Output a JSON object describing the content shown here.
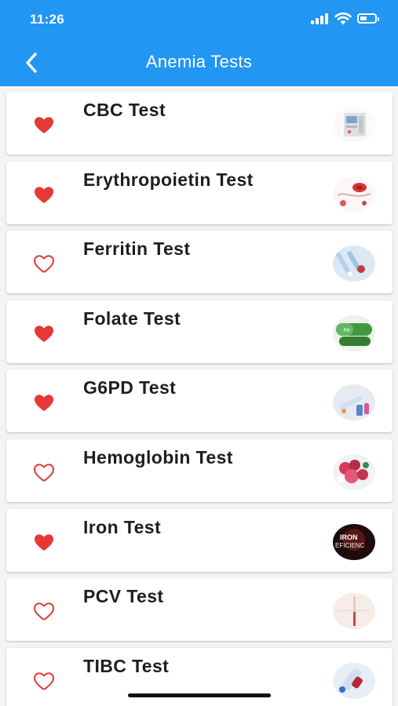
{
  "status_bar": {
    "time": "11:26"
  },
  "header": {
    "title": "Anemia Tests",
    "back_icon": "chevron-left-icon"
  },
  "colors": {
    "header_background": "#2196f3",
    "heart": "#e53935"
  },
  "tests": [
    {
      "name": "CBC Test",
      "favorite": true,
      "image": "hematology-analyzer-machine"
    },
    {
      "name": "Erythropoietin Test",
      "favorite": true,
      "image": "red-blood-cell-diagram"
    },
    {
      "name": "Ferritin Test",
      "favorite": false,
      "image": "blood-tubes-and-pills"
    },
    {
      "name": "Folate Test",
      "favorite": true,
      "image": "green-supplement-capsules"
    },
    {
      "name": "G6PD Test",
      "favorite": true,
      "image": "syringe-and-vials"
    },
    {
      "name": "Hemoglobin Test",
      "favorite": false,
      "image": "hemoglobin-molecule"
    },
    {
      "name": "Iron Test",
      "favorite": true,
      "image": "iron-deficiency-poster"
    },
    {
      "name": "PCV Test",
      "favorite": false,
      "image": "capillary-tube"
    },
    {
      "name": "TIBC Test",
      "favorite": false,
      "image": "blood-sample-tube"
    }
  ]
}
